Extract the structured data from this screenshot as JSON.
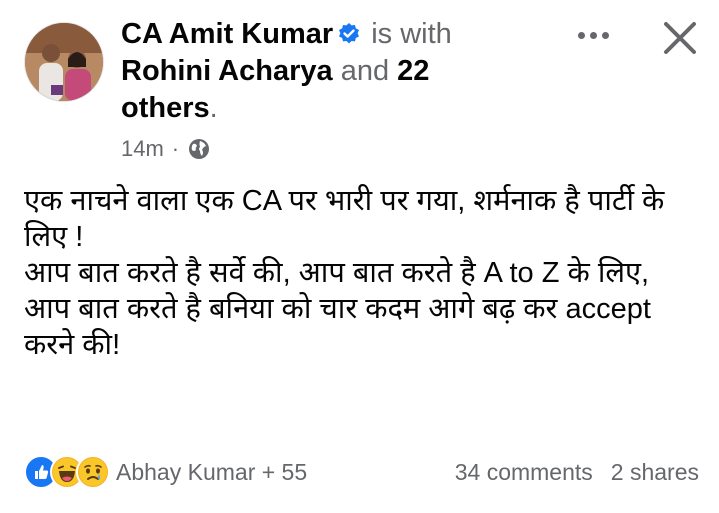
{
  "post": {
    "author": "CA Amit Kumar",
    "with_text": "is with",
    "tagged_person": "Rohini Acharya",
    "and_text": "and",
    "others_count": "22",
    "others_word": "others",
    "period": ".",
    "time": "14m",
    "separator": "·",
    "privacy_icon": "globe-icon",
    "body_line1": "एक नाचने वाला एक CA पर भारी पर गया, शर्मनाक है पार्टी के लिए !",
    "body_line2": "आप बात करते है सर्वे की, आप बात करते है A to Z के लिए, आप बात करते है बनिया को चार कदम आगे बढ़ कर accept करने की!"
  },
  "reactions": {
    "types": [
      "like",
      "haha",
      "sad"
    ],
    "names": "Abhay Kumar + 55",
    "comments": "34 comments",
    "shares": "2 shares"
  },
  "colors": {
    "accent": "#1877f2",
    "muted": "#65676b",
    "text": "#050505"
  }
}
